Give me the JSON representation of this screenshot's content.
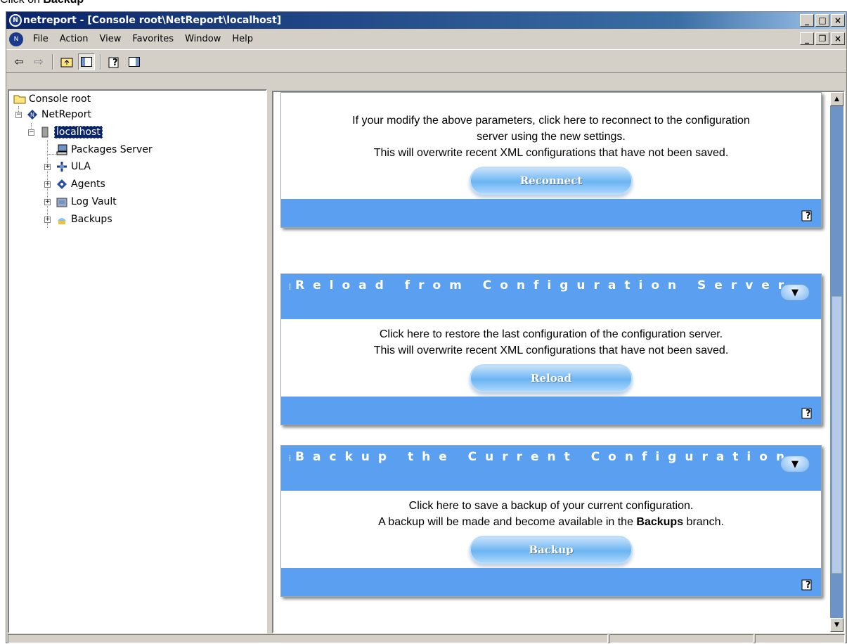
{
  "caption": {
    "prefix": "Click on ",
    "bold": "Backup"
  },
  "window": {
    "title": "netreport - [Console root\\NetReport\\localhost]",
    "controls": [
      "_",
      "□",
      "×"
    ]
  },
  "menu": {
    "items": [
      "File",
      "Action",
      "View",
      "Favorites",
      "Window",
      "Help"
    ],
    "controls": [
      "_",
      "❐",
      "×"
    ]
  },
  "toolbar": {
    "buttons": [
      "back-icon",
      "forward-icon",
      "up-folder-icon",
      "show-tree-icon",
      "help-icon",
      "action-pane-icon"
    ]
  },
  "tree": {
    "root": "Console root",
    "netreport": "NetReport",
    "localhost": "localhost",
    "children": [
      "Packages Server",
      "ULA",
      "Agents",
      "Log Vault",
      "Backups"
    ]
  },
  "panels": {
    "reconnect": {
      "lines": [
        "If your modify the above parameters, click here to reconnect to the configuration",
        "server using the new settings.",
        "This will overwrite recent XML configurations that have not been saved."
      ],
      "button": "Reconnect"
    },
    "reload": {
      "title": "Reload from Configuration Server",
      "lines": [
        "Click here to restore the last configuration of the configuration server.",
        "This will overwrite recent XML configurations that have not been saved."
      ],
      "button": "Reload"
    },
    "backup": {
      "title": "Backup the Current Configuration",
      "line1": "Click here to save a backup of your current configuration.",
      "line2_pre": "A backup will be made and become available in the ",
      "line2_bold": "Backups",
      "line2_post": " branch.",
      "button": "Backup"
    }
  },
  "colors": {
    "panel_blue": "#5a9ff0",
    "title_dark": "#0a246a",
    "scroll_blue": "#6e93c6"
  }
}
